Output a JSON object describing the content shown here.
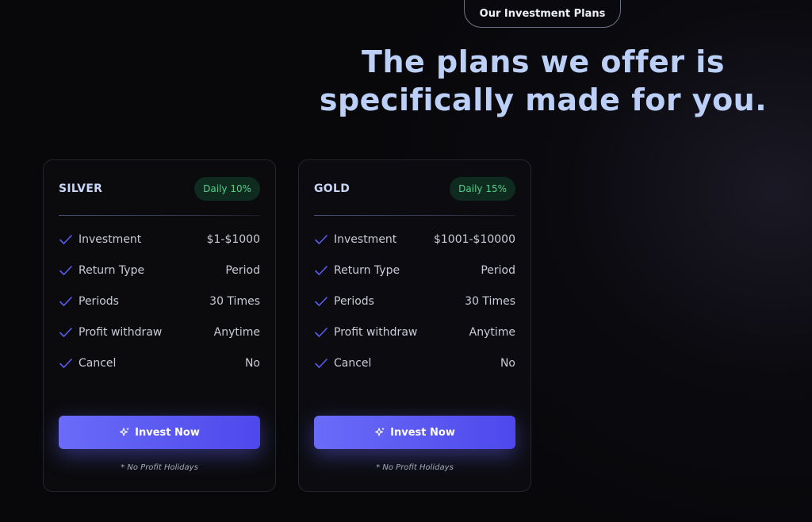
{
  "section": {
    "eyebrow": "Our Investment Plans",
    "headline_line1": "The plans we offer is",
    "headline_line2": "specifically made for you."
  },
  "plans": [
    {
      "name": "SILVER",
      "badge": "Daily 10%",
      "rows": [
        {
          "label": "Investment",
          "value": "$1-$1000"
        },
        {
          "label": "Return Type",
          "value": "Period"
        },
        {
          "label": "Periods",
          "value": "30 Times"
        },
        {
          "label": "Profit withdraw",
          "value": "Anytime"
        },
        {
          "label": "Cancel",
          "value": "No"
        }
      ],
      "button": "Invest Now",
      "note": "* No Profit Holidays"
    },
    {
      "name": "GOLD",
      "badge": "Daily 15%",
      "rows": [
        {
          "label": "Investment",
          "value": "$1001-$10000"
        },
        {
          "label": "Return Type",
          "value": "Period"
        },
        {
          "label": "Periods",
          "value": "30 Times"
        },
        {
          "label": "Profit withdraw",
          "value": "Anytime"
        },
        {
          "label": "Cancel",
          "value": "No"
        }
      ],
      "button": "Invest Now",
      "note": "* No Profit Holidays"
    }
  ],
  "icons": {
    "row_icon": "check-icon",
    "button_icon": "sparkle-icon"
  },
  "colors": {
    "accent": "#5b5cf0",
    "badge_text": "#4fd18b",
    "headline": "#bcd0f7"
  }
}
